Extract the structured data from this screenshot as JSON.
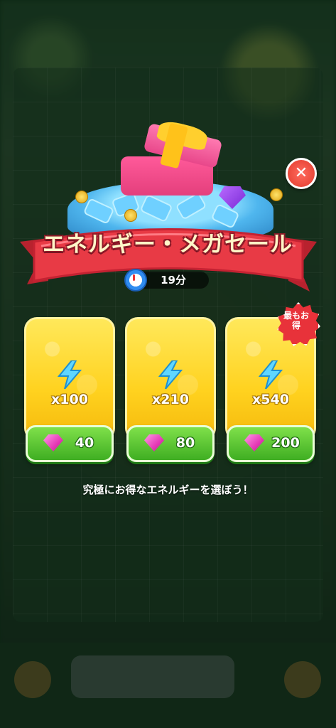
{
  "banner": {
    "title": "エネルギー・メガセール"
  },
  "timer": {
    "icon": "stopwatch-icon",
    "text": "19分"
  },
  "close": {
    "icon": "close-icon",
    "glyph": "✕"
  },
  "offers": [
    {
      "quantity": "x100",
      "price": "40",
      "icon": "energy-bolt-icon"
    },
    {
      "quantity": "x210",
      "price": "80",
      "icon": "energy-bolt-icon"
    },
    {
      "quantity": "x540",
      "price": "200",
      "icon": "energy-bolt-icon"
    }
  ],
  "best_badge": {
    "line1": "最もお",
    "line2": "得"
  },
  "footer": {
    "message": "究極にお得なエネルギーを選ぼう！"
  },
  "colors": {
    "ribbon": "#e83a45",
    "card": "#ffd21f",
    "price_button": "#4fc12a",
    "close": "#e23a2c"
  }
}
